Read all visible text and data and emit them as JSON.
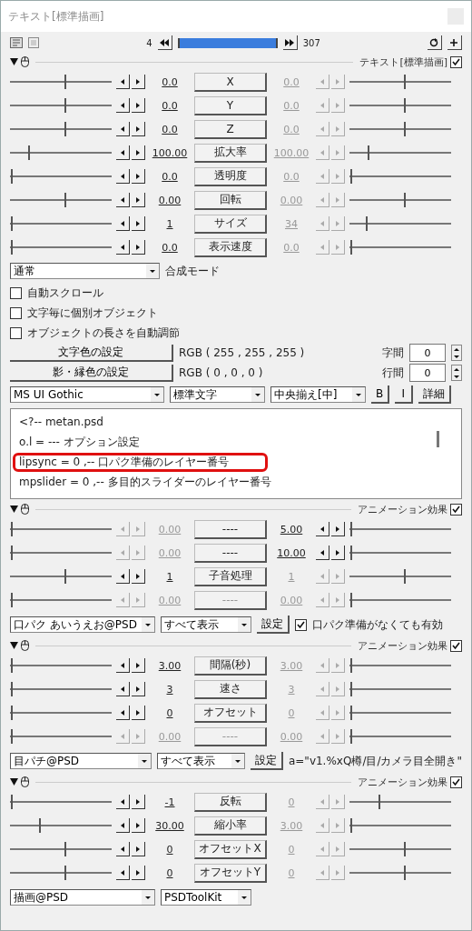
{
  "window": {
    "title": "テキスト[標準描画]"
  },
  "toolbar": {
    "start_frame": "4",
    "end_frame": "307"
  },
  "text_object": {
    "title": "テキスト[標準描画]",
    "enabled": true,
    "tracks": [
      {
        "label": "X",
        "button_active": true,
        "start": "0.0",
        "start_active": true,
        "end": "0.0",
        "end_active": false,
        "left": {
          "level": 0.55
        },
        "right": {
          "level": 0.55
        }
      },
      {
        "label": "Y",
        "button_active": true,
        "start": "0.0",
        "start_active": true,
        "end": "0.0",
        "end_active": false,
        "left": {
          "level": 0.55
        },
        "right": {
          "level": 0.55
        }
      },
      {
        "label": "Z",
        "button_active": true,
        "start": "0.0",
        "start_active": true,
        "end": "0.0",
        "end_active": false,
        "left": {
          "level": 0.55
        },
        "right": {
          "level": 0.55
        }
      },
      {
        "label": "拡大率",
        "button_active": true,
        "start": "100.00",
        "start_active": true,
        "end": "100.00",
        "end_active": false,
        "left": {
          "level": 0.2
        },
        "right": {
          "level": 0.2
        }
      },
      {
        "label": "透明度",
        "button_active": true,
        "start": "0.0",
        "start_active": true,
        "end": "0.0",
        "end_active": false,
        "left": {
          "level": 0.03
        },
        "right": {
          "level": 0.03
        }
      },
      {
        "label": "回転",
        "button_active": true,
        "start": "0.00",
        "start_active": true,
        "end": "0.00",
        "end_active": false,
        "left": {
          "level": 0.55
        },
        "right": {
          "level": 0.55
        }
      },
      {
        "label": "サイズ",
        "button_active": true,
        "start": "1",
        "start_active": true,
        "end": "34",
        "end_active": false,
        "left": {
          "level": 0.03
        },
        "right": {
          "level": 0.18
        }
      },
      {
        "label": "表示速度",
        "button_active": true,
        "start": "0.0",
        "start_active": true,
        "end": "0.0",
        "end_active": false,
        "left": {
          "level": 0.03
        },
        "right": {
          "level": 0.03
        }
      }
    ],
    "blend_mode": {
      "value": "通常",
      "label": "合成モード"
    },
    "options": [
      {
        "label": "自動スクロール",
        "checked": false
      },
      {
        "label": "文字毎に個別オブジェクト",
        "checked": false
      },
      {
        "label": "オブジェクトの長さを自動調節",
        "checked": false
      }
    ],
    "colors": [
      {
        "button": "文字色の設定",
        "value": "RGB ( 255 , 255 , 255 )",
        "spacing_label": "字間",
        "spacing_value": "0"
      },
      {
        "button": "影・縁色の設定",
        "value": "RGB ( 0 , 0 , 0 )",
        "spacing_label": "行間",
        "spacing_value": "0"
      }
    ],
    "font": "MS UI Gothic",
    "style": "標準文字",
    "align": "中央揃え[中]",
    "format_buttons": [
      "B",
      "I",
      "詳細"
    ],
    "text_lines": [
      {
        "text": "<?-- metan.psd",
        "highlighted": false
      },
      {
        "text": "o.l = --- オプション設定",
        "highlighted": false
      },
      {
        "text": "lipsync = 0   ,-- 口パク準備のレイヤー番号",
        "highlighted": true
      },
      {
        "text": "mpslider = 0   ,-- 多目的スライダーのレイヤー番号",
        "highlighted": false
      }
    ]
  },
  "filters": [
    {
      "title": "アニメーション効果",
      "enabled": true,
      "tracks": [
        {
          "label": "----",
          "button_active": true,
          "start": "0.00",
          "start_active": false,
          "end": "5.00",
          "end_active": true,
          "left": {
            "level": 0.03
          },
          "right": {
            "level": 0.03
          }
        },
        {
          "label": "----",
          "button_active": true,
          "start": "0.00",
          "start_active": false,
          "end": "10.00",
          "end_active": true,
          "left": {
            "level": 0.03
          },
          "right": {
            "level": 0.03
          }
        },
        {
          "label": "子音処理",
          "button_active": true,
          "start": "1",
          "start_active": true,
          "end": "1",
          "end_active": false,
          "left": {
            "level": 0.55
          },
          "right": {
            "level": 0.55
          }
        },
        {
          "label": "----",
          "button_active": false,
          "start": "0.00",
          "start_active": false,
          "end": "0.00",
          "end_active": false,
          "left": {
            "level": 0.03
          },
          "right": {
            "level": 0.03
          }
        }
      ],
      "effect": "口パク あいうえお@PSD",
      "display": "すべて表示",
      "settings_button": "設定",
      "extra": {
        "kind": "checkbox",
        "label": "口パク準備がなくても有効",
        "checked": true
      }
    },
    {
      "title": "アニメーション効果",
      "enabled": true,
      "tracks": [
        {
          "label": "間隔(秒)",
          "button_active": true,
          "start": "3.00",
          "start_active": true,
          "end": "3.00",
          "end_active": false,
          "left": {
            "level": 0.03
          },
          "right": {
            "level": 0.03
          }
        },
        {
          "label": "速さ",
          "button_active": true,
          "start": "3",
          "start_active": true,
          "end": "3",
          "end_active": false,
          "left": {
            "level": 0.03
          },
          "right": {
            "level": 0.03
          }
        },
        {
          "label": "オフセット",
          "button_active": true,
          "start": "0",
          "start_active": true,
          "end": "0",
          "end_active": false,
          "left": {
            "level": 0.03
          },
          "right": {
            "level": 0.03
          }
        },
        {
          "label": "----",
          "button_active": false,
          "start": "0.00",
          "start_active": false,
          "end": "0.00",
          "end_active": false,
          "left": {
            "level": 0.03
          },
          "right": {
            "level": 0.03
          }
        }
      ],
      "effect": "目パチ@PSD",
      "display": "すべて表示",
      "settings_button": "設定",
      "extra": {
        "kind": "text",
        "label": "a=\"v1.%xQ樽/目/カメラ目全開き\""
      }
    },
    {
      "title": "アニメーション効果",
      "enabled": true,
      "tracks": [
        {
          "label": "反転",
          "button_active": true,
          "start": "-1",
          "start_active": true,
          "end": "0",
          "end_active": false,
          "left": {
            "level": 0.03
          },
          "right": {
            "level": 0.3
          }
        },
        {
          "label": "縮小率",
          "button_active": true,
          "start": "30.00",
          "start_active": true,
          "end": "3.00",
          "end_active": false,
          "left": {
            "level": 0.3
          },
          "right": {
            "level": 0.03
          }
        },
        {
          "label": "オフセットX",
          "button_active": true,
          "start": "0",
          "start_active": true,
          "end": "0",
          "end_active": false,
          "left": {
            "level": 0.55
          },
          "right": {
            "level": 0.55
          }
        },
        {
          "label": "オフセットY",
          "button_active": true,
          "start": "0",
          "start_active": true,
          "end": "0",
          "end_active": false,
          "left": {
            "level": 0.55
          },
          "right": {
            "level": 0.55
          }
        }
      ],
      "effect": "描画@PSD",
      "display": "PSDToolKit"
    }
  ]
}
